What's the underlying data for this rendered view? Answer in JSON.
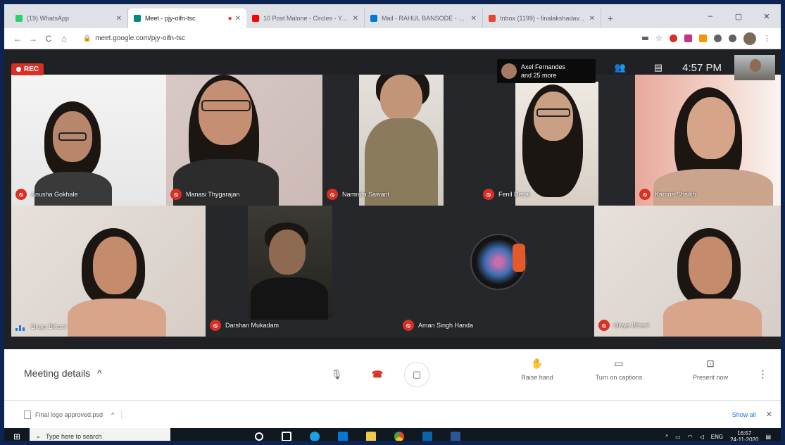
{
  "browser": {
    "tabs": [
      {
        "label": "(19) WhatsApp",
        "color": "#25d366",
        "active": false
      },
      {
        "label": "Meet - pjy-oifn-tsc",
        "color": "#00897b",
        "active": true
      },
      {
        "label": "10 Post Malone - Circles - You...",
        "color": "#ff0000",
        "active": false
      },
      {
        "label": "Mail - RAHUL BANSODE - Out...",
        "color": "#0078d4",
        "active": false
      },
      {
        "label": "Inbox (1199) - finalakshadav...",
        "color": "#ea4335",
        "active": false
      }
    ],
    "new_tab": "+",
    "window_controls": [
      "–",
      "▢",
      "✕"
    ],
    "url": "meet.google.com/pjy-oifn-tsc",
    "nav": [
      "←",
      "→",
      "C",
      "⌂"
    ]
  },
  "meet": {
    "rec_label": "REC",
    "presenter": {
      "name": "Axel Fernandes",
      "extra": "and 25 more"
    },
    "people_icon": "people-icon",
    "chat_icon": "chat-icon",
    "time": "4:57 PM",
    "participants": [
      {
        "name": "Anusha Gokhale",
        "muted": true
      },
      {
        "name": "Manasi Thygarajan",
        "muted": true
      },
      {
        "name": "Namrata Sawant",
        "muted": true
      },
      {
        "name": "Fenil Desai",
        "muted": true
      },
      {
        "name": "Karima Shaikh",
        "muted": true
      },
      {
        "name": "Divya Bihani",
        "muted": false
      },
      {
        "name": "Darshan Mukadam",
        "muted": true
      },
      {
        "name": "Aman Singh Handa",
        "muted": true
      },
      {
        "name": "Divya Bihani",
        "muted": true
      }
    ]
  },
  "controls": {
    "meeting_details": "Meeting details",
    "meeting_details_chevron": "^",
    "mic": "mic-icon",
    "hangup": "hangup-icon",
    "camera": "camera-icon",
    "raise_hand": "Raise hand",
    "captions": "Turn on captions",
    "present": "Present now",
    "more": "⋮"
  },
  "downloads": {
    "file": "Final logo approved.psd",
    "chevron": "^",
    "show_all": "Show all",
    "close": "✕"
  },
  "taskbar": {
    "search_placeholder": "Type here to search",
    "tray_lang": "ENG",
    "time": "16:57",
    "date": "24-11-2020"
  }
}
